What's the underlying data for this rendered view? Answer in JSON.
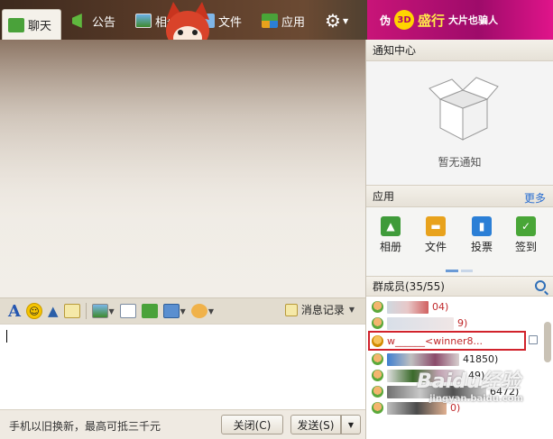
{
  "tabs": [
    {
      "label": "聊天",
      "icon": "chat-icon",
      "active": true
    },
    {
      "label": "公告",
      "icon": "megaphone-icon"
    },
    {
      "label": "相册",
      "icon": "photo-album-icon"
    },
    {
      "label": "文件",
      "icon": "folder-icon"
    },
    {
      "label": "应用",
      "icon": "apps-grid-icon"
    }
  ],
  "ad": {
    "prefix": "伪",
    "logo": "3D",
    "mid": "盛行",
    "tail": "大片也骗人"
  },
  "toolbar": {
    "history_label": "消息记录"
  },
  "bottom": {
    "tip": "手机以旧换新，最高可抵三千元",
    "close_label": "关闭(C)",
    "send_label": "发送(S)",
    "send_menu": "▼"
  },
  "notice": {
    "title": "通知中心",
    "empty_text": "暂无通知"
  },
  "apps": {
    "title": "应用",
    "more": "更多",
    "items": [
      {
        "label": "相册",
        "icon": "album-icon",
        "color": "#3f9b3a"
      },
      {
        "label": "文件",
        "icon": "folder-icon",
        "color": "#e8a21c"
      },
      {
        "label": "投票",
        "icon": "vote-chart-icon",
        "color": "#2b7fd6"
      },
      {
        "label": "签到",
        "icon": "checkin-icon",
        "color": "#49a637"
      }
    ]
  },
  "members": {
    "title": "群成员(35/55)",
    "rows": [
      {
        "text": "04)",
        "red": true
      },
      {
        "text": "9)",
        "red": true
      },
      {
        "text": "w______<winner8...",
        "red": true,
        "highlight": true
      },
      {
        "text": "41850)",
        "red": false
      },
      {
        "text": "49)",
        "red": false
      },
      {
        "text": "6472)",
        "red": false
      },
      {
        "text": "0)",
        "red": true
      }
    ]
  },
  "watermark": {
    "main": "Baidu经验",
    "sub": "jingyan.baidu.com"
  },
  "colors": {
    "accent_link": "#2b6fd1",
    "highlight_box": "#d1222b",
    "member_name_red": "#c0292b"
  }
}
